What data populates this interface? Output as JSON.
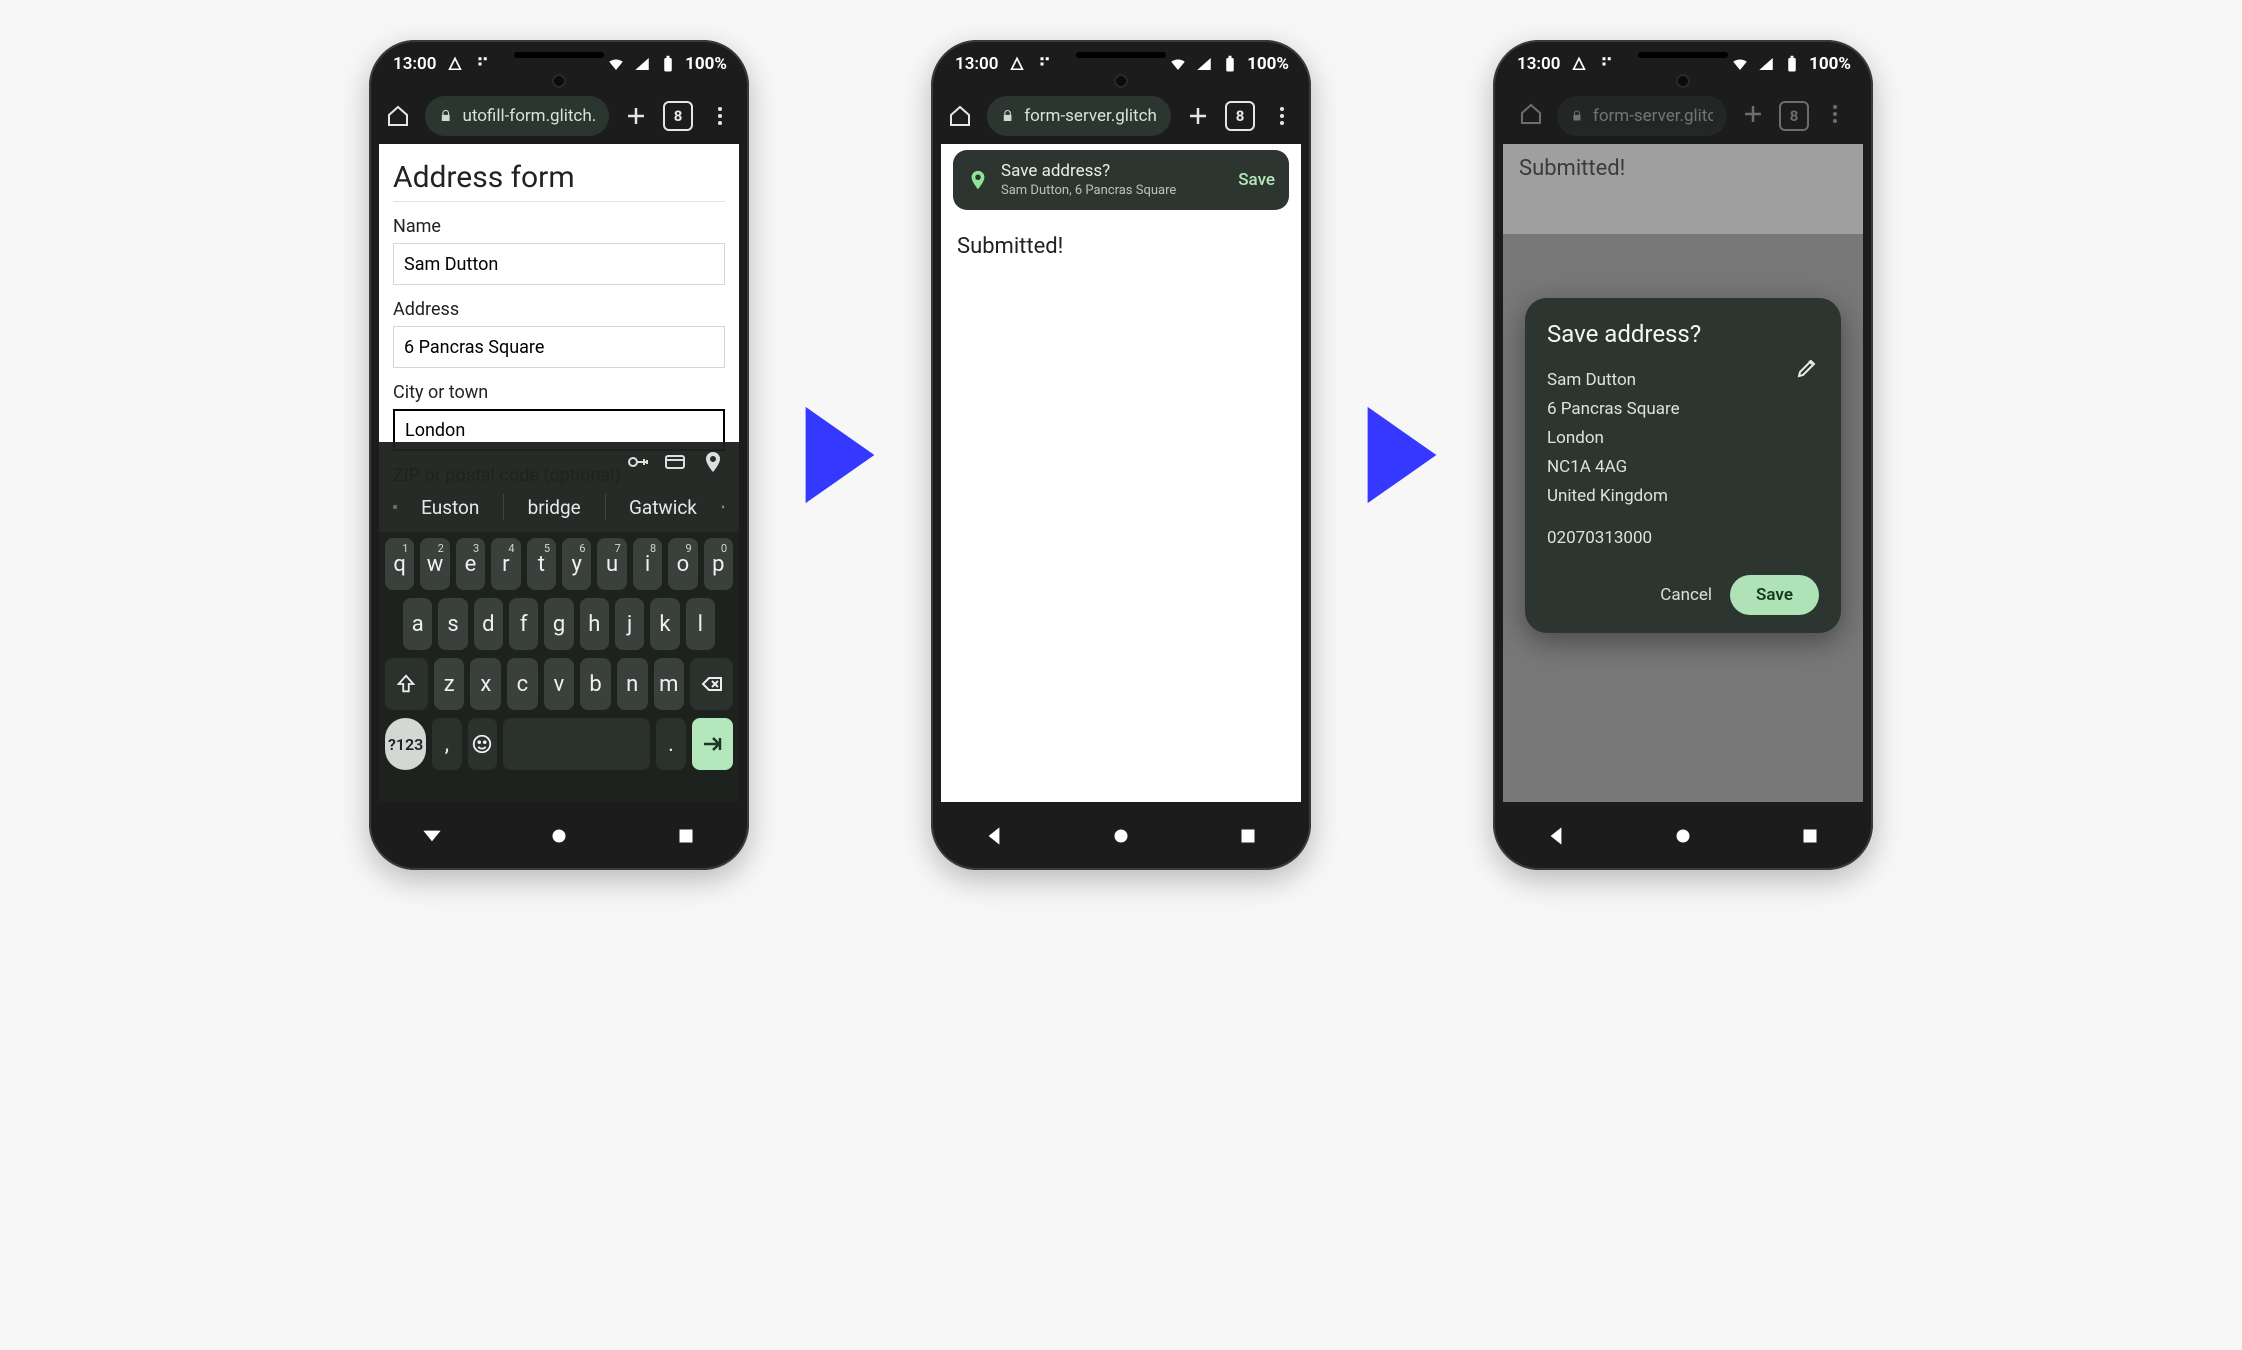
{
  "statusbar": {
    "time": "13:00",
    "battery": "100%"
  },
  "tabs_count": "8",
  "screen1": {
    "url": "utofill-form.glitch.me",
    "title": "Address form",
    "fields": {
      "name_label": "Name",
      "name_value": "Sam Dutton",
      "address_label": "Address",
      "address_value": "6 Pancras Square",
      "city_label": "City or town",
      "city_value": "London",
      "zip_label": "ZIP or postal code (optional)"
    },
    "suggestions": [
      "Euston",
      "bridge",
      "Gatwick"
    ],
    "keyboard": {
      "row1": [
        [
          "q",
          "1"
        ],
        [
          "w",
          "2"
        ],
        [
          "e",
          "3"
        ],
        [
          "r",
          "4"
        ],
        [
          "t",
          "5"
        ],
        [
          "y",
          "6"
        ],
        [
          "u",
          "7"
        ],
        [
          "i",
          "8"
        ],
        [
          "o",
          "9"
        ],
        [
          "p",
          "0"
        ]
      ],
      "row2": [
        "a",
        "s",
        "d",
        "f",
        "g",
        "h",
        "j",
        "k",
        "l"
      ],
      "row3": [
        "z",
        "x",
        "c",
        "v",
        "b",
        "n",
        "m"
      ],
      "num_label": "?123"
    }
  },
  "screen2": {
    "url": "form-server.glitch.me",
    "pill_title": "Save address?",
    "pill_subtitle": "Sam Dutton, 6 Pancras Square",
    "pill_action": "Save",
    "body": "Submitted!"
  },
  "screen3": {
    "url": "form-server.glitch.me",
    "body": "Submitted!",
    "modal_title": "Save address?",
    "lines": [
      "Sam Dutton",
      "6 Pancras Square",
      "London",
      "NC1A 4AG",
      "United Kingdom"
    ],
    "phone": "02070313000",
    "cancel": "Cancel",
    "save": "Save"
  }
}
